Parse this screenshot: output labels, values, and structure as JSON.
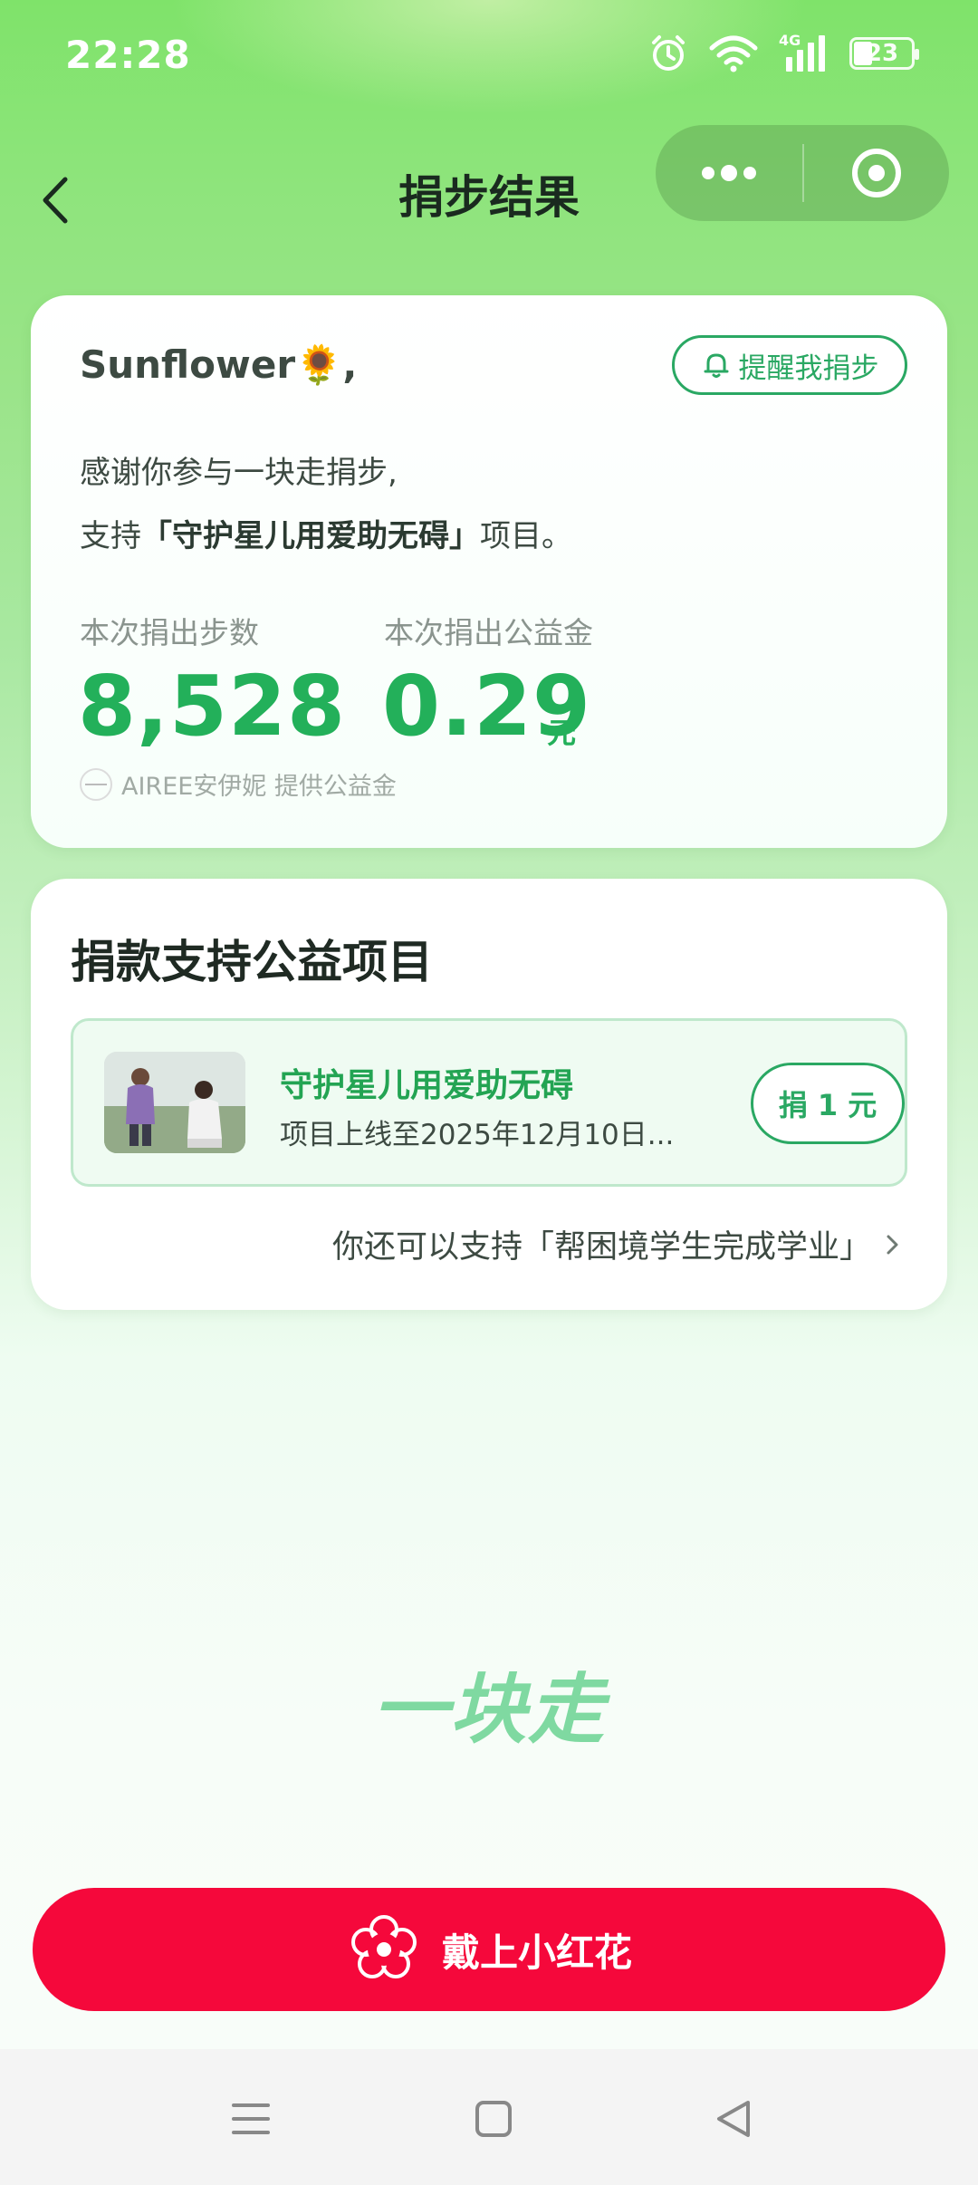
{
  "status_bar": {
    "time": "22:28",
    "network": "4G",
    "battery": "23"
  },
  "nav": {
    "title": "捐步结果"
  },
  "result_card": {
    "greeting": "Sunflower🌻,",
    "remind_label": "提醒我捐步",
    "thanks_text": "感谢你参与一块走捐步,",
    "support_prefix": "支持",
    "project_name_quoted": "「守护星儿用爱助无碍」",
    "support_suffix": "项目。",
    "steps_label": "本次捐出步数",
    "steps_value": "8,528",
    "money_label": "本次捐出公益金",
    "money_value": "0.29",
    "money_unit": "元",
    "sponsor_text": "AIREE安伊妮 提供公益金"
  },
  "project_card": {
    "title": "捐款支持公益项目",
    "project_name": "守护星儿用爱助无碍",
    "project_desc": "项目上线至2025年12月10日...",
    "donate_label": "捐 1 元",
    "more_text": "你还可以支持「帮困境学生完成学业」"
  },
  "brand_text": "一块走",
  "bottom_button": {
    "label": "戴上小红花"
  },
  "colors": {
    "accent_green": "#23b05a",
    "red": "#f5083b"
  }
}
